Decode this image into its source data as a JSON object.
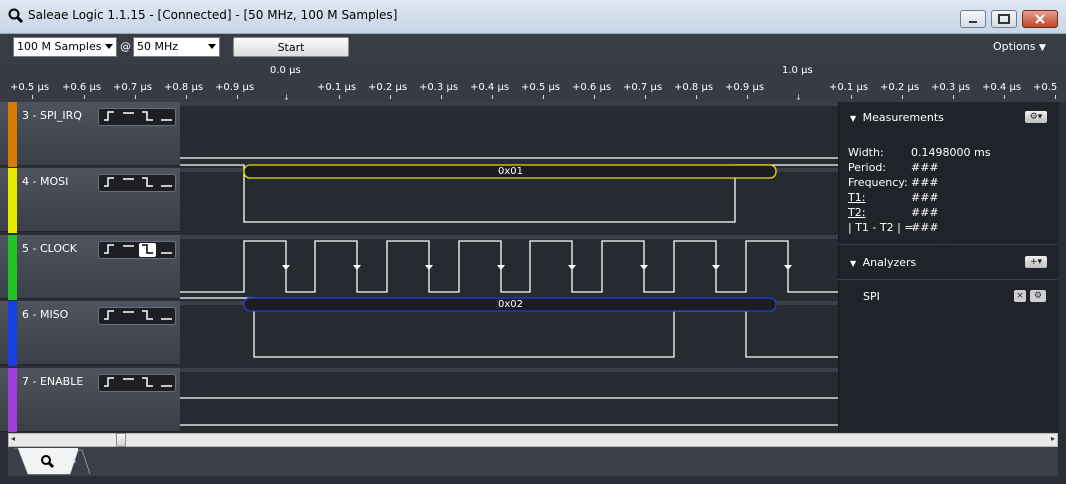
{
  "window": {
    "title": "Saleae Logic 1.1.15 - [Connected] - [50 MHz, 100 M Samples]"
  },
  "toolbar": {
    "samples_value": "100 M Samples",
    "at_label": "@",
    "rate_value": "50 MHz",
    "start_label": "Start",
    "options_label": "Options"
  },
  "ruler": {
    "top_labels": [
      "0.0 µs",
      "1.0 µs"
    ],
    "ticks": [
      "+0.5 µs",
      "+0.6 µs",
      "+0.7 µs",
      "+0.8 µs",
      "+0.9 µs",
      "+0.1 µs",
      "+0.2 µs",
      "+0.3 µs",
      "+0.4 µs",
      "+0.5 µs",
      "+0.6 µs",
      "+0.7 µs",
      "+0.8 µs",
      "+0.9 µs",
      "+0.1 µs",
      "+0.2 µs",
      "+0.3 µs",
      "+0.4 µs",
      "+0.5"
    ]
  },
  "channels": [
    {
      "name": "3 - SPI_IRQ",
      "color": "#d67a00",
      "selected_trigger": "none"
    },
    {
      "name": "4 - MOSI",
      "color": "#e8e800",
      "selected_trigger": "none",
      "decode": "0x01"
    },
    {
      "name": "5 - CLOCK",
      "color": "#22c422",
      "selected_trigger": "falling"
    },
    {
      "name": "6 - MISO",
      "color": "#1a3fe0",
      "selected_trigger": "none",
      "decode": "0x02"
    },
    {
      "name": "7 - ENABLE",
      "color": "#9b3fd6",
      "selected_trigger": "none"
    }
  ],
  "trigger_glyphs": [
    "rising-edge-icon",
    "high-level-icon",
    "falling-edge-icon",
    "low-level-icon"
  ],
  "measurements": {
    "header": "Measurements",
    "rows": [
      {
        "label": "Width:",
        "value": "0.1498000 ms"
      },
      {
        "label": "Period:",
        "value": "###"
      },
      {
        "label": "Frequency:",
        "value": "###"
      },
      {
        "label": "T1:",
        "value": "###"
      },
      {
        "label": "T2:",
        "value": "###"
      },
      {
        "label": "| T1 - T2 | =",
        "value": "###"
      }
    ]
  },
  "analyzers": {
    "header": "Analyzers",
    "items": [
      {
        "name": "SPI"
      }
    ]
  }
}
